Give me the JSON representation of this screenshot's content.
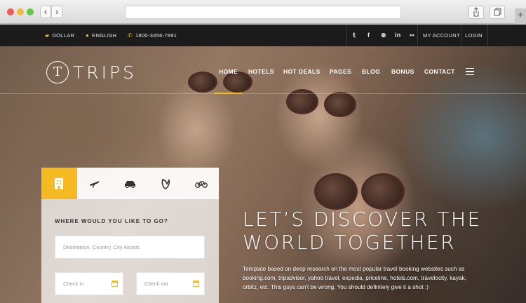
{
  "topbar": {
    "currency": "DOLLAR",
    "language": "ENGLISH",
    "phone": "1800-3456-7891",
    "social_icons": [
      "twitter-icon",
      "facebook-icon",
      "dribbble-icon",
      "linkedin-icon",
      "flickr-icon"
    ],
    "account": "MY ACCOUNT",
    "login": "LOGIN"
  },
  "brand": {
    "initial": "T",
    "name": "TRIPS"
  },
  "nav": {
    "items": [
      "HOME",
      "HOTELS",
      "HOT DEALS",
      "PAGES",
      "BLOG",
      "BONUS",
      "CONTACT"
    ],
    "active": "HOME"
  },
  "search": {
    "tabs": [
      "hotel-icon",
      "flight-icon",
      "car-icon",
      "cruise-icon",
      "bicycle-icon"
    ],
    "title": "WHERE WOULD YOU LIKE TO GO?",
    "destination_placeholder": "Destination, Country, City Airport,",
    "checkin_placeholder": "Check in",
    "checkout_placeholder": "Check out"
  },
  "hero": {
    "headline_line1": "LET’S DISCOVER THE",
    "headline_line2": "WORLD TOGETHER",
    "description": "Template based on deep research on the most popular travel booking websites such as booking.com, tripadvisor, yahoo travel, expedia, priceline, hotels.com, travelocity, kayak, orbitz, etc. This guys can't be wrong. You should definitely give it a shot :)"
  },
  "colors": {
    "accent": "#f5b921",
    "topbar_bg": "#1b1b1b"
  }
}
